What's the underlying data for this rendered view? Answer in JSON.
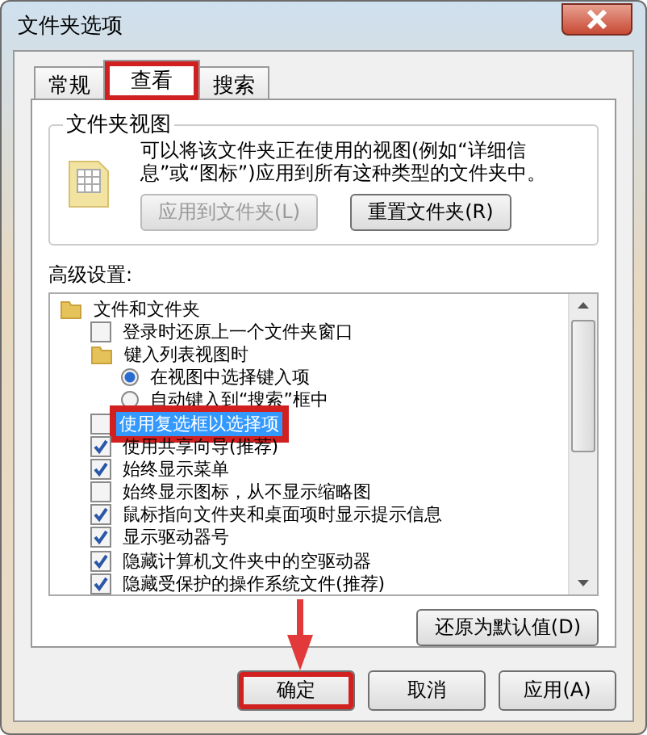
{
  "window": {
    "title": "文件夹选项"
  },
  "tabs": [
    {
      "label": "常规",
      "selected": false,
      "highlighted": false
    },
    {
      "label": "查看",
      "selected": true,
      "highlighted": true
    },
    {
      "label": "搜索",
      "selected": false,
      "highlighted": false
    }
  ],
  "folder_views": {
    "title": "文件夹视图",
    "description": "可以将该文件夹正在使用的视图(例如“详细信息”或“图标”)应用到所有这种类型的文件夹中。",
    "buttons": [
      {
        "label": "应用到文件夹(L)",
        "disabled": true
      },
      {
        "label": "重置文件夹(R)",
        "disabled": false
      }
    ]
  },
  "advanced": {
    "label": "高级设置:",
    "items": [
      {
        "kind": "folder",
        "label": "文件和文件夹",
        "children": [
          {
            "kind": "checkbox",
            "label": "登录时还原上一个文件夹窗口",
            "checked": false,
            "selected": false,
            "highlighted": false
          },
          {
            "kind": "folder",
            "label": "键入列表视图时",
            "children": [
              {
                "kind": "radio",
                "label": "在视图中选择键入项",
                "checked": true,
                "selected": false,
                "highlighted": false
              },
              {
                "kind": "radio",
                "label": "自动键入到“搜索”框中",
                "checked": false,
                "selected": false,
                "highlighted": false
              }
            ]
          },
          {
            "kind": "checkbox",
            "label": "使用复选框以选择项",
            "checked": false,
            "selected": true,
            "highlighted": true
          },
          {
            "kind": "checkbox",
            "label": "使用共享向导(推荐)",
            "checked": true,
            "selected": false,
            "highlighted": false
          },
          {
            "kind": "checkbox",
            "label": "始终显示菜单",
            "checked": true,
            "selected": false,
            "highlighted": false
          },
          {
            "kind": "checkbox",
            "label": "始终显示图标，从不显示缩略图",
            "checked": false,
            "selected": false,
            "highlighted": false
          },
          {
            "kind": "checkbox",
            "label": "鼠标指向文件夹和桌面项时显示提示信息",
            "checked": true,
            "selected": false,
            "highlighted": false
          },
          {
            "kind": "checkbox",
            "label": "显示驱动器号",
            "checked": true,
            "selected": false,
            "highlighted": false
          },
          {
            "kind": "checkbox",
            "label": "隐藏计算机文件夹中的空驱动器",
            "checked": true,
            "selected": false,
            "highlighted": false
          },
          {
            "kind": "checkbox",
            "label": "隐藏受保护的操作系统文件(推荐)",
            "checked": true,
            "selected": false,
            "highlighted": false
          }
        ]
      }
    ],
    "restore_button": "还原为默认值(D)"
  },
  "buttons": [
    {
      "label": "确定",
      "highlighted": true
    },
    {
      "label": "取消",
      "highlighted": false
    },
    {
      "label": "应用(A)",
      "highlighted": false
    }
  ]
}
